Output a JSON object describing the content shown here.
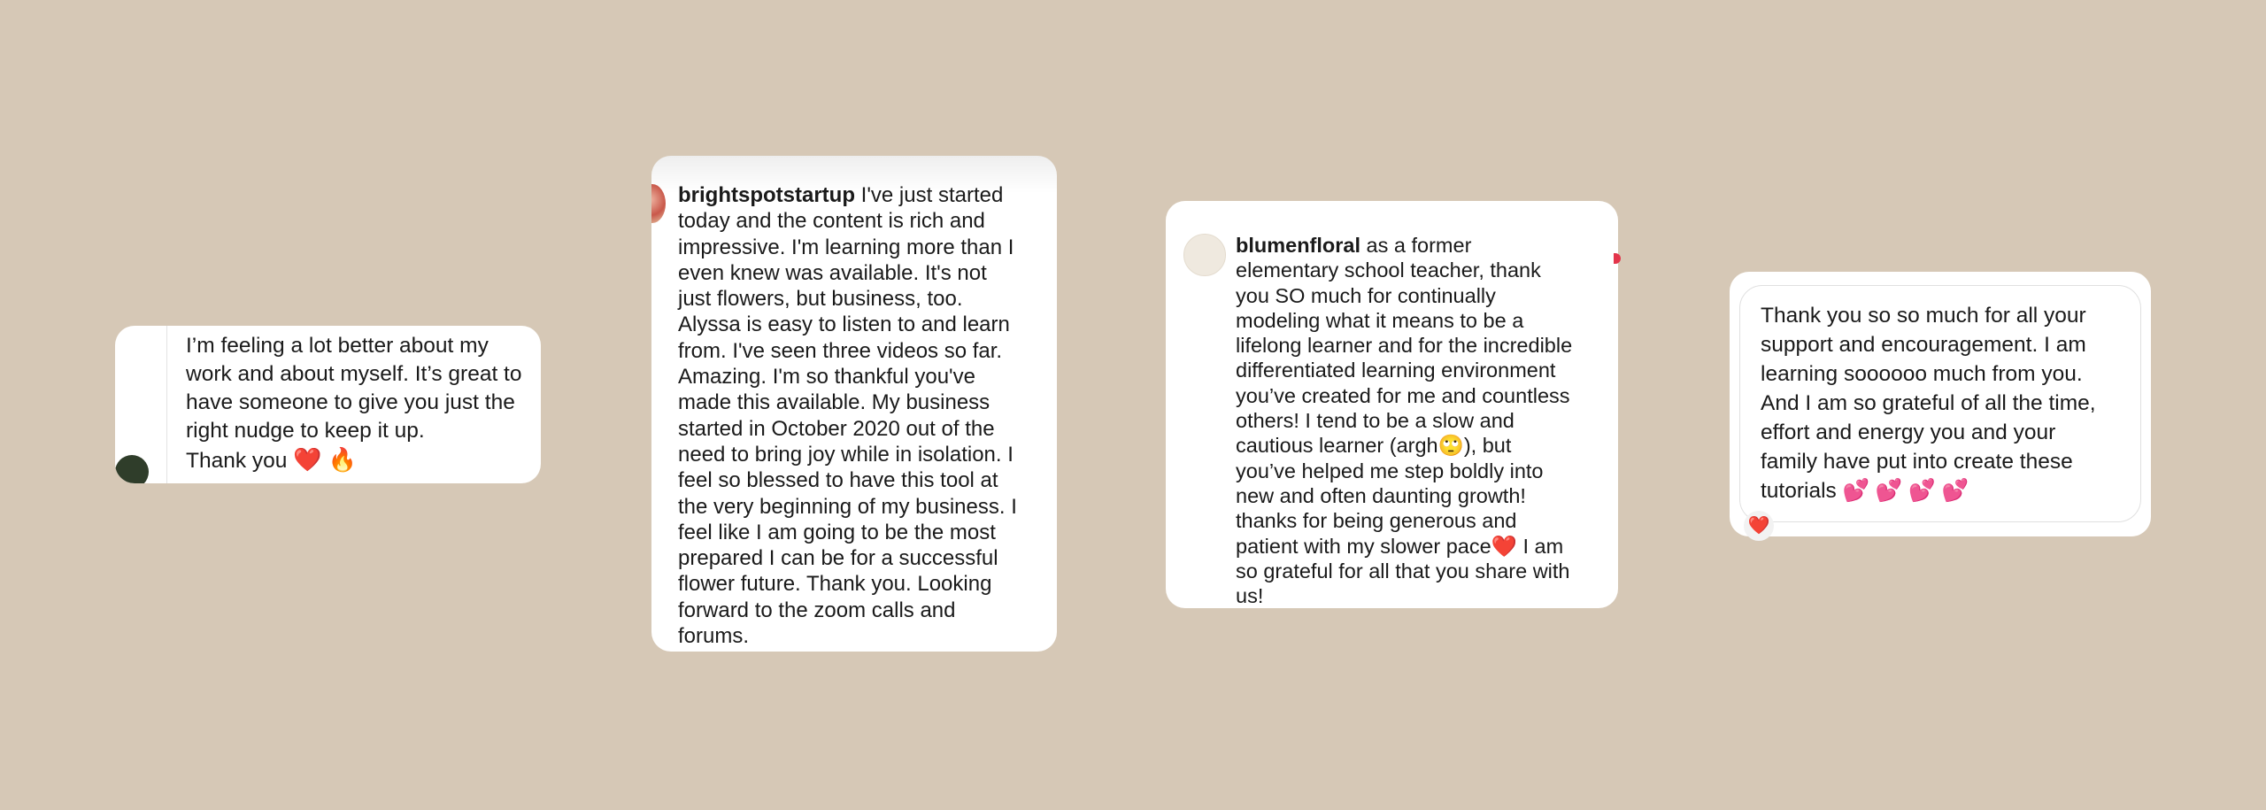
{
  "cards": [
    {
      "avatar_text": "",
      "lines": [
        "I’m feeling a lot better about my",
        "work and about myself. It’s great to",
        "have someone to give you just the",
        "right nudge to keep it up."
      ],
      "last_line": "Thank you",
      "emojis": "❤️ 🔥"
    },
    {
      "username": "brightspotstartup",
      "first_line": "I've just started",
      "lines": [
        "today and the content is rich and",
        "impressive.  I'm learning more than I",
        "even knew was available.  It's not",
        "just flowers, but business, too.",
        "Alyssa is easy to listen to and learn",
        "from.  I've seen three videos so far.",
        "Amazing.  I'm so thankful you've",
        "made this available.  My business",
        "started in October 2020 out of the",
        "need to bring joy while in isolation.  I",
        "feel so blessed to have this tool at",
        "the very beginning of my business.  I",
        "feel like I am going to be the most",
        "prepared I can be for a successful",
        "flower future.  Thank you.  Looking",
        "forward to the zoom calls and",
        "forums."
      ]
    },
    {
      "username": "blumenfloral",
      "avatar_text": "",
      "first_line": "as a former",
      "lines": [
        "elementary school teacher, thank",
        "you SO much for continually",
        "modeling what it means to be a",
        "lifelong learner and for the incredible",
        "differentiated learning environment",
        "you’ve created for me and countless",
        "others! I tend to be a slow and",
        "cautious learner (argh🙄), but",
        "you’ve helped me step boldly into",
        "new and often daunting growth!",
        "thanks for being generous and",
        "patient with my slower pace❤️ I am",
        "so grateful for all that you share with",
        "us!"
      ]
    },
    {
      "lines": [
        "Thank you so so much for all your",
        "support and encouragement. I am",
        "learning soooooo much from you.",
        "And I am so grateful of all the time,",
        "effort and energy you and your",
        "family have put into create these",
        "tutorials 💕 💕 💕 💕"
      ],
      "reaction": "❤️"
    }
  ]
}
